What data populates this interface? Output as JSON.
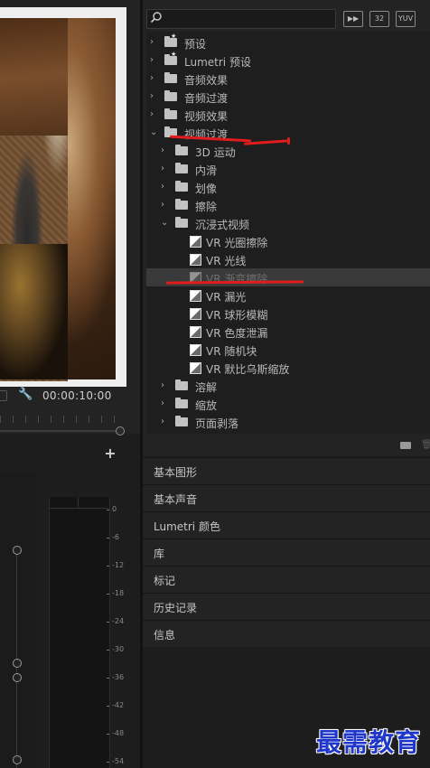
{
  "program_monitor": {
    "timecode": "00:00:10:00"
  },
  "effects": {
    "header_icons": [
      {
        "name": "accelerated-effects",
        "glyph": "▶▶"
      },
      {
        "name": "32-bit-color",
        "text": "32"
      },
      {
        "name": "yuv-effects",
        "text": "YUV"
      }
    ],
    "tree": [
      {
        "label": "预设",
        "depth": 0,
        "expanded": false,
        "kind": "folder-star"
      },
      {
        "label": "Lumetri 预设",
        "depth": 0,
        "expanded": false,
        "kind": "folder-star"
      },
      {
        "label": "音频效果",
        "depth": 0,
        "expanded": false,
        "kind": "folder"
      },
      {
        "label": "音频过渡",
        "depth": 0,
        "expanded": false,
        "kind": "folder"
      },
      {
        "label": "视频效果",
        "depth": 0,
        "expanded": false,
        "kind": "folder"
      },
      {
        "label": "视频过渡",
        "depth": 0,
        "expanded": true,
        "kind": "folder"
      },
      {
        "label": "3D 运动",
        "depth": 1,
        "expanded": false,
        "kind": "folder"
      },
      {
        "label": "内滑",
        "depth": 1,
        "expanded": false,
        "kind": "folder"
      },
      {
        "label": "划像",
        "depth": 1,
        "expanded": false,
        "kind": "folder"
      },
      {
        "label": "擦除",
        "depth": 1,
        "expanded": false,
        "kind": "folder"
      },
      {
        "label": "沉浸式视频",
        "depth": 1,
        "expanded": true,
        "kind": "folder"
      },
      {
        "label": "VR 光圈擦除",
        "depth": 2,
        "kind": "effect"
      },
      {
        "label": "VR 光线",
        "depth": 2,
        "kind": "effect"
      },
      {
        "label": "VR 渐变擦除",
        "depth": 2,
        "kind": "effect",
        "selected": true
      },
      {
        "label": "VR 漏光",
        "depth": 2,
        "kind": "effect"
      },
      {
        "label": "VR 球形模糊",
        "depth": 2,
        "kind": "effect"
      },
      {
        "label": "VR 色度泄漏",
        "depth": 2,
        "kind": "effect"
      },
      {
        "label": "VR 随机块",
        "depth": 2,
        "kind": "effect"
      },
      {
        "label": "VR 默比乌斯缩放",
        "depth": 2,
        "kind": "effect"
      },
      {
        "label": "溶解",
        "depth": 1,
        "expanded": false,
        "kind": "folder"
      },
      {
        "label": "缩放",
        "depth": 1,
        "expanded": false,
        "kind": "folder"
      },
      {
        "label": "页面剥落",
        "depth": 1,
        "expanded": false,
        "kind": "folder"
      }
    ]
  },
  "panels": [
    "基本图形",
    "基本声音",
    "Lumetri 颜色",
    "库",
    "标记",
    "历史记录",
    "信息"
  ],
  "audio_meter": {
    "db_labels": [
      "0",
      "-6",
      "-12",
      "-18",
      "-24",
      "-30",
      "-36",
      "-42",
      "-48",
      "-54"
    ]
  },
  "watermark": "最需教育",
  "colors": {
    "annotation": "#e01c1c",
    "watermark": "#1f37c8",
    "panel_bg": "#232323"
  }
}
